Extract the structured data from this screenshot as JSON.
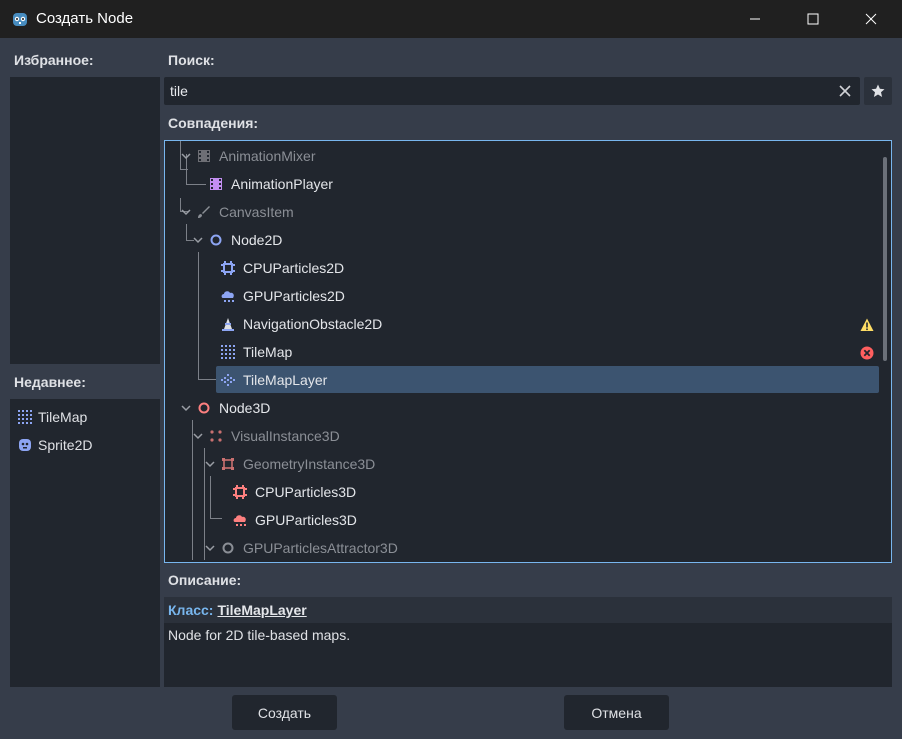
{
  "window": {
    "title": "Создать Node"
  },
  "favorites": {
    "label": "Избранное:"
  },
  "recent": {
    "label": "Недавнее:",
    "items": [
      {
        "label": "TileMap",
        "icon": "tilemap-icon"
      },
      {
        "label": "Sprite2D",
        "icon": "sprite2d-icon"
      }
    ]
  },
  "search": {
    "label": "Поиск:",
    "value": "tile"
  },
  "matches": {
    "label": "Совпадения:",
    "items": [
      {
        "label": "AnimationMixer",
        "icon": "animation-mixer-icon",
        "style": "dim"
      },
      {
        "label": "AnimationPlayer",
        "icon": "animation-player-icon",
        "style": "bright"
      },
      {
        "label": "CanvasItem",
        "icon": "canvas-item-icon",
        "style": "dim"
      },
      {
        "label": "Node2D",
        "icon": "node2d-icon",
        "style": "bright"
      },
      {
        "label": "CPUParticles2D",
        "icon": "cpu-particles2d-icon",
        "style": "bright"
      },
      {
        "label": "GPUParticles2D",
        "icon": "gpu-particles2d-icon",
        "style": "bright"
      },
      {
        "label": "NavigationObstacle2D",
        "icon": "navigation-obstacle2d-icon",
        "style": "bright",
        "status": "warning"
      },
      {
        "label": "TileMap",
        "icon": "tilemap-icon",
        "style": "bright",
        "status": "error"
      },
      {
        "label": "TileMapLayer",
        "icon": "tilemap-layer-icon",
        "style": "bright",
        "selected": true
      },
      {
        "label": "Node3D",
        "icon": "node3d-icon",
        "style": "bright"
      },
      {
        "label": "VisualInstance3D",
        "icon": "visual-instance3d-icon",
        "style": "dim"
      },
      {
        "label": "GeometryInstance3D",
        "icon": "geometry-instance3d-icon",
        "style": "dim"
      },
      {
        "label": "CPUParticles3D",
        "icon": "cpu-particles3d-icon",
        "style": "bright"
      },
      {
        "label": "GPUParticles3D",
        "icon": "gpu-particles3d-icon",
        "style": "bright"
      },
      {
        "label": "GPUParticlesAttractor3D",
        "icon": "gpu-particles-attractor3d-icon",
        "style": "dim"
      }
    ]
  },
  "description": {
    "label": "Описание:",
    "class_prefix": "Класс:",
    "class_name": "TileMapLayer",
    "text": "Node for 2D tile-based maps."
  },
  "buttons": {
    "create": "Создать",
    "cancel": "Отмена"
  },
  "colors": {
    "accent": "#78b6ee",
    "selection": "#3c5470",
    "node2d": "#8da5f3",
    "node3d": "#fc7f7f",
    "warning": "#ffdd65",
    "error": "#ff5f5f",
    "animation": "#c38ef1"
  }
}
